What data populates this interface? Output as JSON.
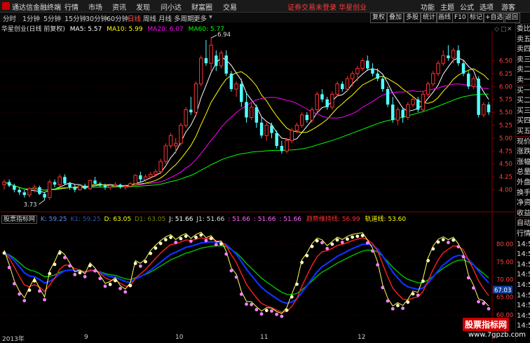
{
  "app": {
    "title": "通达信金融终端"
  },
  "menu": [
    "行情",
    "市场",
    "资讯",
    "发现",
    "问小达",
    "财富圈",
    "交易"
  ],
  "alert": {
    "text": "证券交易未登录  华星创业"
  },
  "right_tools": [
    "功能",
    "主题",
    "公式",
    "选项"
  ],
  "guest": "游客",
  "periods": [
    "分时",
    "1分钟",
    "5分钟",
    "15分钟",
    "30分钟",
    "60分钟",
    "日线",
    "周线",
    "月线",
    "多周期",
    "更多"
  ],
  "active_period": "日线",
  "right_buttons": [
    "复权",
    "叠加",
    "多股",
    "统计",
    "画线",
    "F10",
    "标记",
    "+自选",
    "返回"
  ],
  "stock": {
    "name_label": "华星创业(日线 前复权)"
  },
  "ma": {
    "ma5": {
      "label": "MA5: 5.57",
      "color": "#ffffff"
    },
    "ma10": {
      "label": "MA10: 5.99",
      "color": "#ffff00"
    },
    "ma20": {
      "label": "MA20: 6.07",
      "color": "#ff00ff"
    },
    "ma60": {
      "label": "MA60: 5.77",
      "color": "#00ff00"
    }
  },
  "price_axis": [
    "6.50",
    "6.25",
    "6.00",
    "5.75",
    "5.50",
    "5.25",
    "5.00",
    "4.75",
    "4.50",
    "4.25",
    "4.00"
  ],
  "annotations": {
    "high": "6.94",
    "low": "3.73"
  },
  "indicator": {
    "name": "股票指标网",
    "k": "K: 59.25",
    "k1": "K1: 59.25",
    "d": "D: 63.05",
    "d1": "D1: 63.05",
    "j": "J: 51.66",
    "j1": "J1: 51.66",
    "c1": ": 51.66",
    "c2": ": 51.66",
    "c3": ": 51.66",
    "trend": "趋势维持线: 56.99",
    "track": "轨道线: 53.60",
    "axis": [
      "80.00",
      "75.00",
      "70.00",
      "65.00",
      "60.00"
    ],
    "current": "67.03"
  },
  "dates": [
    "2013年",
    "9",
    "10",
    "11",
    "12"
  ],
  "sidebar": [
    "委比",
    "卖五",
    "卖四",
    "卖三",
    "卖二",
    "卖一",
    "买一",
    "买二",
    "买三",
    "买四",
    "买五",
    "现价",
    "涨跌",
    "涨幅",
    "总量",
    "外盘",
    "换手",
    "净资",
    "收益",
    "自动",
    "行情",
    "14:5",
    "14:5",
    "14:5",
    "14:5",
    "14:5",
    "14:5",
    "14:5",
    "14:5",
    "14:5"
  ],
  "watermark": {
    "brand": "股票指标网",
    "url": "www.7gpzb.com"
  },
  "chart_data": {
    "type": "candlestick",
    "title": "华星创业(日线 前复权)",
    "ylim": [
      3.6,
      7.05
    ],
    "y_ticks": [
      4.0,
      4.25,
      4.5,
      4.75,
      5.0,
      5.25,
      5.5,
      5.75,
      6.0,
      6.25,
      6.5
    ],
    "candles": [
      [
        4.1,
        4.2,
        4.0,
        4.15
      ],
      [
        4.15,
        4.2,
        4.05,
        4.08
      ],
      [
        4.08,
        4.12,
        3.95,
        4.0
      ],
      [
        4.0,
        4.05,
        3.9,
        3.95
      ],
      [
        3.95,
        4.0,
        3.85,
        3.9
      ],
      [
        3.9,
        4.05,
        3.85,
        4.02
      ],
      [
        4.02,
        4.1,
        3.95,
        4.05
      ],
      [
        4.05,
        4.08,
        3.9,
        3.92
      ],
      [
        3.92,
        3.95,
        3.8,
        3.85
      ],
      [
        3.85,
        4.2,
        3.8,
        4.15
      ],
      [
        4.15,
        4.2,
        4.05,
        4.1
      ],
      [
        4.1,
        4.3,
        4.05,
        4.25
      ],
      [
        4.25,
        4.3,
        4.1,
        4.12
      ],
      [
        4.12,
        4.15,
        4.0,
        4.05
      ],
      [
        4.05,
        4.1,
        3.95,
        4.0
      ],
      [
        4.0,
        4.1,
        3.98,
        4.08
      ],
      [
        4.08,
        4.12,
        4.0,
        4.02
      ],
      [
        4.02,
        4.2,
        4.0,
        4.18
      ],
      [
        4.18,
        4.25,
        4.1,
        4.12
      ],
      [
        4.12,
        4.15,
        4.05,
        4.08
      ],
      [
        4.08,
        4.12,
        4.0,
        4.05
      ],
      [
        4.05,
        4.1,
        4.0,
        4.08
      ],
      [
        4.08,
        4.15,
        4.05,
        4.1
      ],
      [
        4.1,
        4.12,
        4.02,
        4.05
      ],
      [
        4.05,
        4.1,
        4.0,
        4.07
      ],
      [
        4.07,
        4.15,
        4.05,
        4.12
      ],
      [
        4.12,
        4.3,
        4.1,
        4.28
      ],
      [
        4.28,
        4.35,
        4.15,
        4.2
      ],
      [
        4.2,
        4.3,
        4.15,
        4.25
      ],
      [
        4.25,
        4.35,
        4.2,
        4.3
      ],
      [
        4.3,
        4.4,
        4.25,
        4.35
      ],
      [
        4.35,
        4.6,
        4.3,
        4.55
      ],
      [
        4.55,
        4.9,
        4.5,
        4.85
      ],
      [
        4.85,
        5.1,
        4.8,
        5.05
      ],
      [
        4.85,
        5.0,
        4.7,
        4.9
      ],
      [
        4.9,
        5.3,
        4.85,
        5.25
      ],
      [
        5.25,
        5.6,
        5.2,
        5.55
      ],
      [
        5.55,
        5.8,
        5.45,
        5.5
      ],
      [
        5.5,
        6.1,
        5.45,
        6.05
      ],
      [
        6.05,
        6.6,
        6.0,
        6.55
      ],
      [
        6.55,
        6.9,
        6.4,
        6.45
      ],
      [
        6.45,
        6.94,
        6.3,
        6.8
      ],
      [
        6.6,
        6.7,
        6.3,
        6.4
      ],
      [
        6.4,
        6.7,
        6.35,
        6.65
      ],
      [
        6.6,
        6.7,
        6.2,
        6.25
      ],
      [
        6.25,
        6.3,
        5.9,
        5.95
      ],
      [
        5.95,
        6.1,
        5.8,
        6.05
      ],
      [
        6.05,
        6.15,
        5.6,
        5.7
      ],
      [
        5.7,
        5.9,
        5.3,
        5.4
      ],
      [
        5.4,
        5.7,
        5.35,
        5.6
      ],
      [
        5.6,
        5.65,
        5.2,
        5.3
      ],
      [
        5.3,
        5.4,
        5.0,
        5.05
      ],
      [
        5.05,
        5.3,
        4.95,
        5.25
      ],
      [
        5.25,
        5.3,
        5.0,
        5.1
      ],
      [
        5.1,
        5.15,
        4.8,
        4.85
      ],
      [
        4.85,
        4.95,
        4.7,
        4.75
      ],
      [
        4.75,
        5.0,
        4.7,
        4.95
      ],
      [
        4.95,
        5.2,
        4.9,
        5.15
      ],
      [
        5.15,
        5.3,
        5.1,
        5.25
      ],
      [
        5.25,
        5.5,
        5.2,
        5.45
      ],
      [
        5.45,
        5.5,
        5.3,
        5.35
      ],
      [
        5.35,
        5.6,
        5.3,
        5.55
      ],
      [
        5.55,
        5.9,
        5.5,
        5.85
      ],
      [
        5.85,
        5.95,
        5.7,
        5.75
      ],
      [
        5.75,
        5.8,
        5.55,
        5.6
      ],
      [
        5.6,
        5.9,
        5.55,
        5.85
      ],
      [
        5.85,
        6.1,
        5.8,
        6.05
      ],
      [
        6.05,
        6.1,
        5.9,
        5.95
      ],
      [
        5.95,
        6.2,
        5.9,
        6.15
      ],
      [
        6.15,
        6.3,
        6.0,
        6.25
      ],
      [
        6.25,
        6.4,
        6.1,
        6.35
      ],
      [
        6.35,
        6.55,
        6.3,
        6.5
      ],
      [
        6.5,
        6.6,
        6.3,
        6.35
      ],
      [
        6.35,
        6.45,
        6.2,
        6.25
      ],
      [
        6.25,
        6.35,
        6.1,
        6.15
      ],
      [
        6.15,
        6.2,
        5.9,
        5.95
      ],
      [
        5.95,
        6.0,
        5.6,
        5.65
      ],
      [
        5.65,
        5.8,
        5.3,
        5.35
      ],
      [
        5.35,
        5.6,
        5.25,
        5.55
      ],
      [
        5.55,
        5.6,
        5.3,
        5.4
      ],
      [
        5.4,
        5.7,
        5.35,
        5.65
      ],
      [
        5.65,
        5.8,
        5.6,
        5.75
      ],
      [
        5.75,
        5.8,
        5.5,
        5.55
      ],
      [
        5.55,
        5.9,
        5.5,
        5.85
      ],
      [
        5.85,
        6.1,
        5.8,
        6.05
      ],
      [
        6.05,
        6.3,
        6.0,
        6.25
      ],
      [
        6.25,
        6.5,
        6.2,
        6.45
      ],
      [
        6.45,
        6.7,
        6.4,
        6.6
      ],
      [
        6.6,
        6.8,
        6.5,
        6.55
      ],
      [
        6.55,
        6.75,
        6.45,
        6.7
      ],
      [
        6.7,
        6.8,
        6.4,
        6.45
      ],
      [
        6.45,
        6.5,
        6.2,
        6.25
      ],
      [
        6.25,
        6.3,
        5.95,
        6.0
      ],
      [
        6.0,
        6.2,
        5.95,
        6.15
      ],
      [
        6.15,
        6.2,
        5.4,
        5.45
      ],
      [
        5.45,
        5.7,
        5.4,
        5.65
      ],
      [
        5.65,
        5.7,
        5.45,
        5.5
      ]
    ]
  }
}
